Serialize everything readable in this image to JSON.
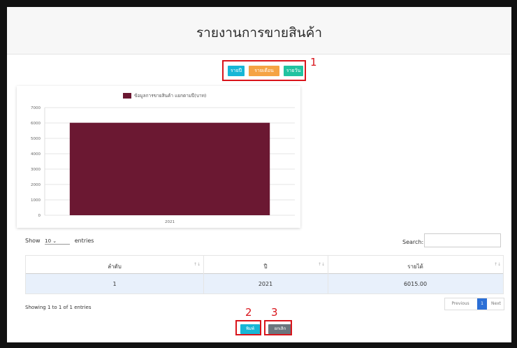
{
  "page": {
    "title": "รายงานการขายสินค้า"
  },
  "filters": {
    "year_button": "รายปี",
    "month_button": "รายเดือน",
    "day_button": "รายวัน"
  },
  "annotations": {
    "n1": "1",
    "n2": "2",
    "n3": "3"
  },
  "chart_data": {
    "type": "bar",
    "legend": "ข้อมูลการขายสินค้า แยกตามปี(บาท)",
    "categories": [
      "2021"
    ],
    "series": [
      {
        "name": "ข้อมูลการขายสินค้า แยกตามปี(บาท)",
        "values": [
          6015
        ]
      }
    ],
    "ylim": [
      0,
      7000
    ],
    "yticks": [
      0,
      1000,
      2000,
      3000,
      4000,
      5000,
      6000,
      7000
    ],
    "grid": true,
    "legend_placement": "top"
  },
  "table_controls": {
    "show_label": "Show",
    "entries_label": "entries",
    "entries_value": "10",
    "search_label": "Search:"
  },
  "table": {
    "headers": [
      "ลำดับ",
      "ปี",
      "รายได้"
    ],
    "rows": [
      [
        "1",
        "2021",
        "6015.00"
      ]
    ]
  },
  "footer": {
    "info": "Showing 1 to 1 of 1 entries",
    "prev": "Previous",
    "page": "1",
    "next": "Next"
  },
  "actions": {
    "print": "พิมพ์",
    "cancel": "ยกเลิก"
  },
  "colors": {
    "bar": "#6b1832",
    "accent_red": "#d9141b"
  }
}
